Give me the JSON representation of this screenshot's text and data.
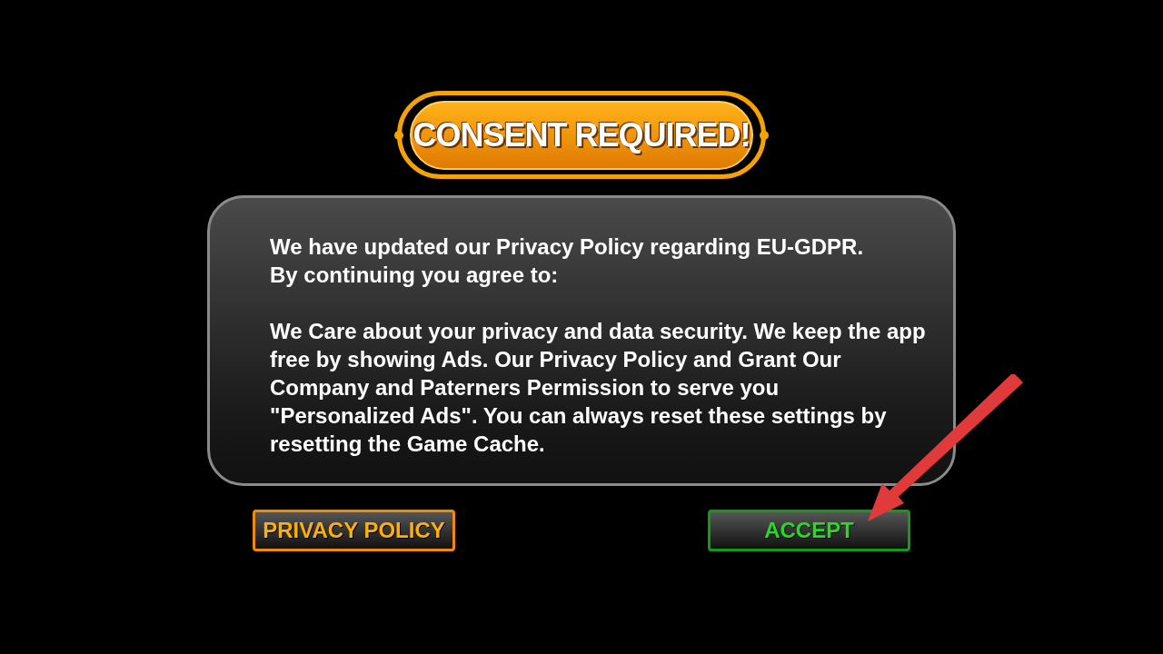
{
  "dialog": {
    "title": "CONSENT REQUIRED!",
    "paragraphs": [
      [
        "We have updated our Privacy Policy regarding EU-GDPR.",
        "By continuing you agree to:"
      ],
      [
        "We Care about your privacy and data security. We keep the app free by showing Ads. Our Privacy Policy and Grant Our Company and Paterners Permission to serve you \"Personalized Ads\". You can always reset these settings by resetting the Game Cache."
      ]
    ],
    "buttons": [
      {
        "label": "PRIVACY POLICY",
        "kind": "secondary"
      },
      {
        "label": "ACCEPT",
        "kind": "primary"
      }
    ]
  }
}
